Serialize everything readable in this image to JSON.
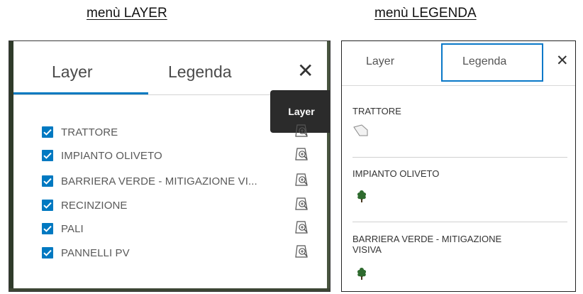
{
  "captions": {
    "left": "menù LAYER",
    "right": "menù LEGENDA"
  },
  "layer_panel": {
    "tabs": [
      "Layer",
      "Legenda"
    ],
    "active_tab": "Layer",
    "close_glyph": "✕",
    "tooltip": "Layer",
    "layers": [
      {
        "label": "TRATTORE",
        "checked": true,
        "icon": "zoom-to-icon"
      },
      {
        "label": "IMPIANTO OLIVETO",
        "checked": true,
        "icon": "zoom-to-icon"
      },
      {
        "label": "BARRIERA VERDE - MITIGAZIONE VI...",
        "checked": true,
        "icon": "zoom-to-icon"
      },
      {
        "label": "RECINZIONE",
        "checked": true,
        "icon": "zoom-to-icon"
      },
      {
        "label": "PALI",
        "checked": true,
        "icon": "zoom-to-icon"
      },
      {
        "label": "PANNELLI PV",
        "checked": true,
        "icon": "zoom-to-icon"
      }
    ]
  },
  "legend_panel": {
    "tabs": [
      "Layer",
      "Legenda"
    ],
    "active_tab": "Legenda",
    "close_glyph": "✕",
    "entries": [
      {
        "title": "TRATTORE",
        "symbol": "tractor-shape-icon"
      },
      {
        "title": "IMPIANTO OLIVETO",
        "symbol": "tree-icon"
      },
      {
        "title": "BARRIERA VERDE - MITIGAZIONE VISIVA",
        "symbol": "tree-icon"
      }
    ]
  },
  "colors": {
    "accent": "#0079c1",
    "tooltip_bg": "#2b2b2b",
    "tree_green": "#2f6b2f"
  }
}
